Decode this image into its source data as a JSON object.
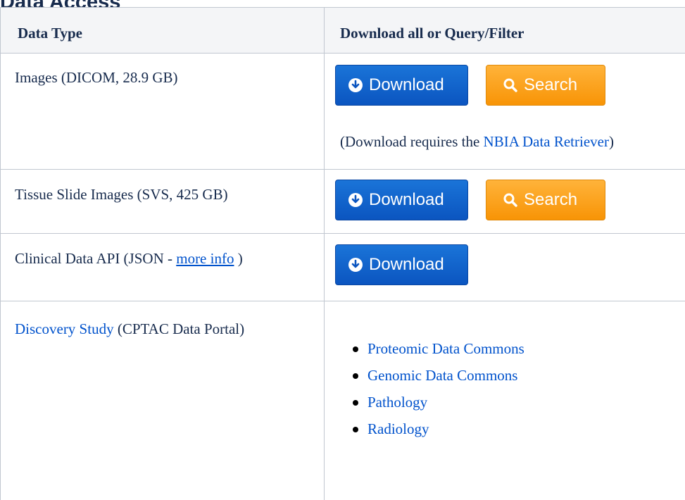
{
  "page": {
    "heading": "Data Access"
  },
  "table": {
    "headers": [
      "Data Type",
      "Download all or Query/Filter"
    ],
    "rows": {
      "images": {
        "label": "Images (DICOM, 28.9 GB)",
        "download_label": "Download",
        "search_label": "Search",
        "note_prefix": "(Download requires the ",
        "note_link": "NBIA Data Retriever",
        "note_suffix": ")"
      },
      "slides": {
        "label": "Tissue Slide Images (SVS, 425 GB)",
        "download_label": "Download",
        "search_label": "Search"
      },
      "clinical": {
        "label_prefix": "Clinical Data API (JSON - ",
        "label_link": "more info",
        "label_suffix": " )",
        "download_label": "Download"
      },
      "discovery": {
        "label_link": "Discovery Study",
        "label_suffix": " (CPTAC Data Portal)",
        "links": [
          "Proteomic Data Commons",
          "Genomic Data Commons",
          "Pathology",
          "Radiology"
        ]
      }
    }
  },
  "icons": {
    "download": "circle-arrow-down-icon",
    "search": "magnifier-icon"
  },
  "colors": {
    "download_button": "#0b5fd0",
    "search_button": "#f89406",
    "link": "#0052cc",
    "text": "#172b4d",
    "header_bg": "#f4f5f7",
    "border": "#c1c7d0"
  }
}
